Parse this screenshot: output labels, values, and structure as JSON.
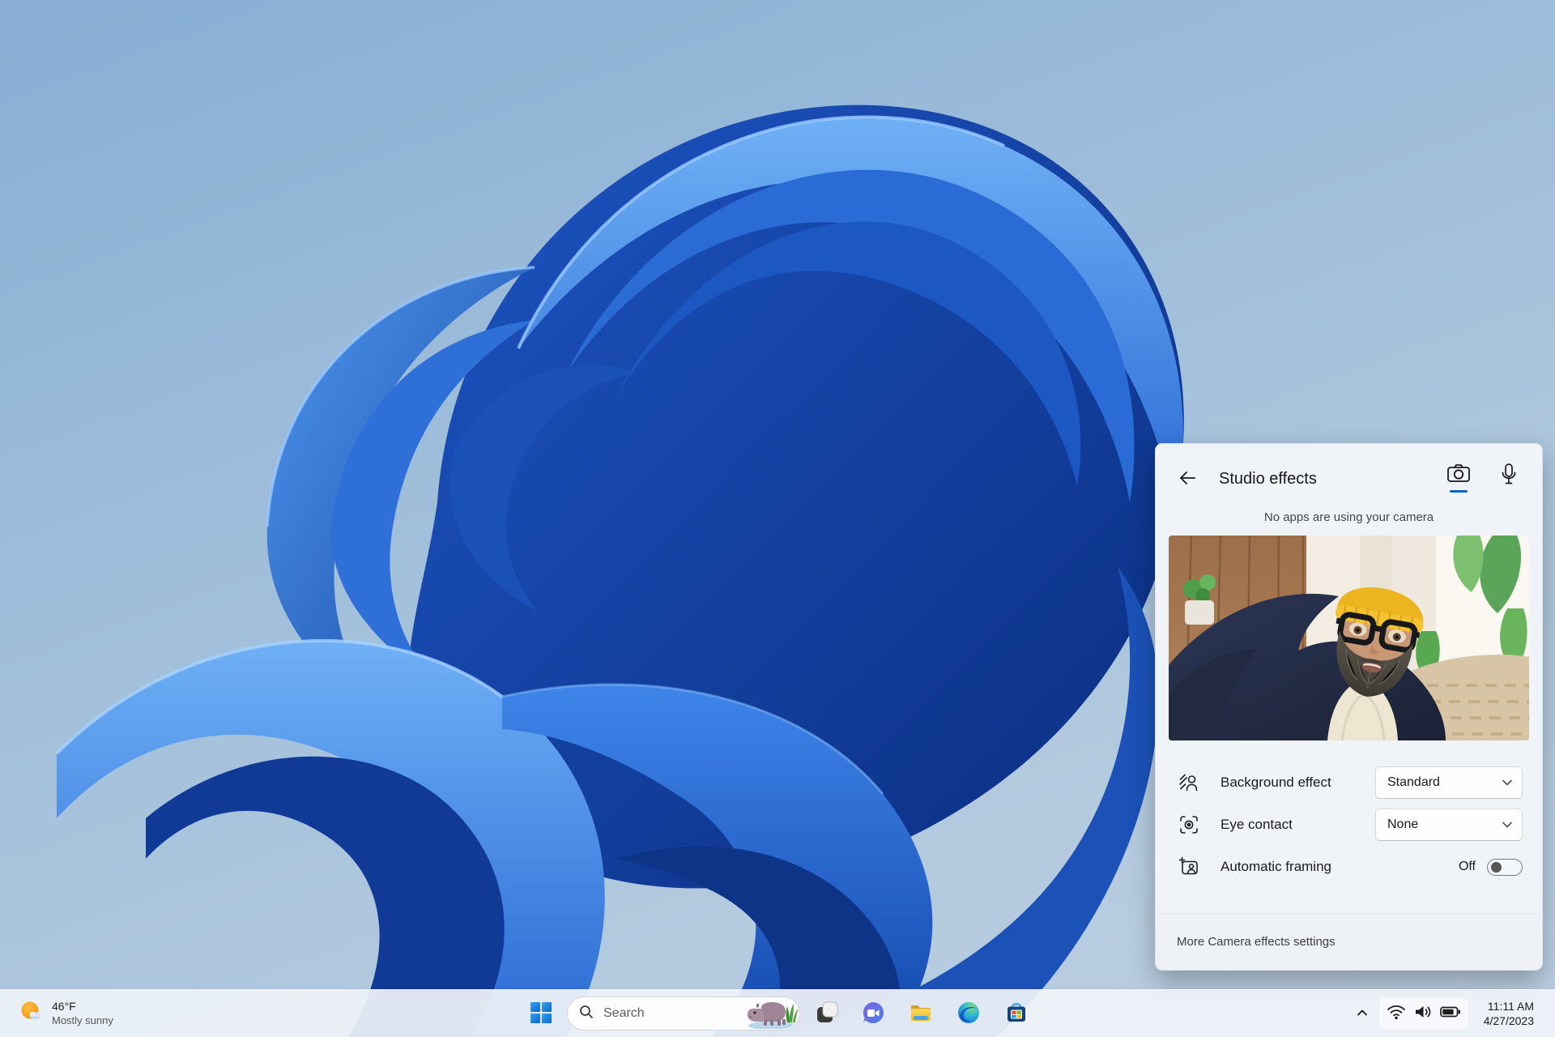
{
  "studio_panel": {
    "title": "Studio effects",
    "status": "No apps are using your camera",
    "tabs": [
      {
        "name": "camera",
        "active": true
      },
      {
        "name": "microphone",
        "active": false
      }
    ],
    "rows": [
      {
        "label": "Background effect",
        "control": "dropdown",
        "value": "Standard"
      },
      {
        "label": "Eye contact",
        "control": "dropdown",
        "value": "None"
      },
      {
        "label": "Automatic framing",
        "control": "toggle",
        "value": "Off"
      }
    ],
    "footer_link": "More Camera effects settings"
  },
  "taskbar": {
    "weather": {
      "temperature": "46°F",
      "condition": "Mostly sunny"
    },
    "search": {
      "placeholder": "Search"
    },
    "app_icons": [
      "start",
      "task-view",
      "chat",
      "file-explorer",
      "edge",
      "microsoft-store"
    ],
    "tray_icons": [
      "chevron-up",
      "wifi",
      "volume",
      "battery"
    ],
    "clock": {
      "time": "11:11 AM",
      "date": "4/27/2023"
    }
  },
  "colors": {
    "accent": "#0067c8",
    "desktop_top": "#88aed4",
    "desktop_bottom": "#bccfe2",
    "bloom_light": "#5ea2f4",
    "bloom_dark": "#0a2f86",
    "panel_bg": "#f0f4f9",
    "taskbar_bg": "#eff3f9"
  }
}
